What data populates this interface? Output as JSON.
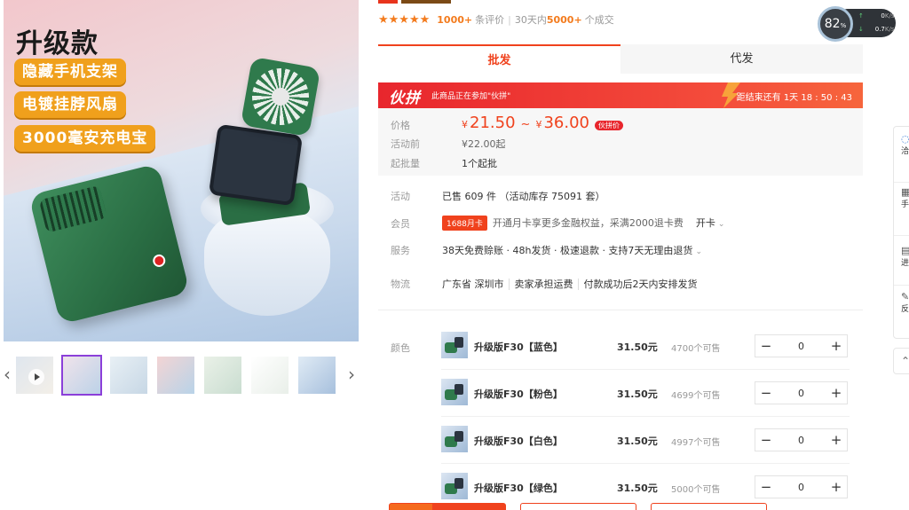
{
  "gallery": {
    "promo_title": "升级款",
    "promo_tags": [
      "隐藏手机支架",
      "电镀挂脖风扇",
      "3000毫安充电宝"
    ],
    "thumbs": [
      {
        "name": "thumb-video",
        "colors": [
          "#dfe6ee",
          "#f3efe8"
        ],
        "has_play": true
      },
      {
        "name": "thumb-2",
        "colors": [
          "#f0e3ea",
          "#bcd2e8"
        ],
        "has_play": false
      },
      {
        "name": "thumb-3",
        "colors": [
          "#e8f0f5",
          "#c7d7e5"
        ],
        "has_play": false
      },
      {
        "name": "thumb-4",
        "colors": [
          "#f3d4d4",
          "#b8d3e8"
        ],
        "has_play": false
      },
      {
        "name": "thumb-5",
        "colors": [
          "#eaf1e8",
          "#c9ddd0"
        ],
        "has_play": false
      },
      {
        "name": "thumb-6",
        "colors": [
          "#ffffff",
          "#e9efe9"
        ],
        "has_play": false
      },
      {
        "name": "thumb-7",
        "colors": [
          "#e0ebf5",
          "#a7c0dd"
        ],
        "has_play": false
      }
    ],
    "prev_icon": "‹",
    "next_icon": "›"
  },
  "rating": {
    "stars": "★★★★★",
    "review_count": "1000+",
    "review_label": "条评价",
    "period_label": "30天内",
    "deal_count": "5000+",
    "deal_label": "个成交"
  },
  "tabs": {
    "wholesale": "批发",
    "dropship": "代发"
  },
  "promo": {
    "logo": "伙拼",
    "description": "此商品正在参加\"伙拼\"",
    "countdown": "距结束还有  1天  18 : 50 : 43"
  },
  "price": {
    "price_label": "价格",
    "currency": "¥",
    "min": "21.50",
    "tilde": "~",
    "max": "36.00",
    "group_tag": "伙拼价",
    "before_label": "活动前",
    "before_value": "¥22.00起",
    "moq_label": "起批量",
    "moq_value": "1个起批"
  },
  "activity": {
    "label": "活动",
    "value": "已售 609 件 （活动库存 75091 套）"
  },
  "member": {
    "label": "会员",
    "badge": "1688月卡",
    "value": "开通月卡享更多金融权益，采满2000退卡费",
    "action": "开卡"
  },
  "service": {
    "label": "服务",
    "value": "38天免费赊账 · 48h发货 · 极速退款 · 支持7天无理由退货"
  },
  "logistics": {
    "label": "物流",
    "origin": "广东省  深圳市",
    "fee": "卖家承担运费",
    "ship": "付款成功后2天内安排发货"
  },
  "sku": {
    "label": "颜色",
    "items": [
      {
        "name": "升级版F30【蓝色】",
        "price": "31.50元",
        "stock": "4700个可售",
        "qty": "0"
      },
      {
        "name": "升级版F30【粉色】",
        "price": "31.50元",
        "stock": "4699个可售",
        "qty": "0"
      },
      {
        "name": "升级版F30【白色】",
        "price": "31.50元",
        "stock": "4997个可售",
        "qty": "0"
      },
      {
        "name": "升级版F30【绿色】",
        "price": "31.50元",
        "stock": "5000个可售",
        "qty": "0"
      }
    ],
    "minus": "−",
    "plus": "+"
  },
  "speed_widget": {
    "percent": "82",
    "percent_unit": "%",
    "up": "0",
    "down": "0.7",
    "unit": "K/s"
  },
  "sidebar": {
    "items": [
      {
        "icon": "◌",
        "label": "洽谈"
      },
      {
        "icon": "▦",
        "label": "手下"
      },
      {
        "icon": "▤",
        "label": "进货"
      },
      {
        "icon": "✎",
        "label": "反馈"
      }
    ],
    "top_icon": "⌃"
  },
  "colors": {
    "accent": "#f0421d",
    "star": "#f37b1d",
    "promo_red": "#e8262d",
    "sidebar_active": "#8b3fd9"
  }
}
